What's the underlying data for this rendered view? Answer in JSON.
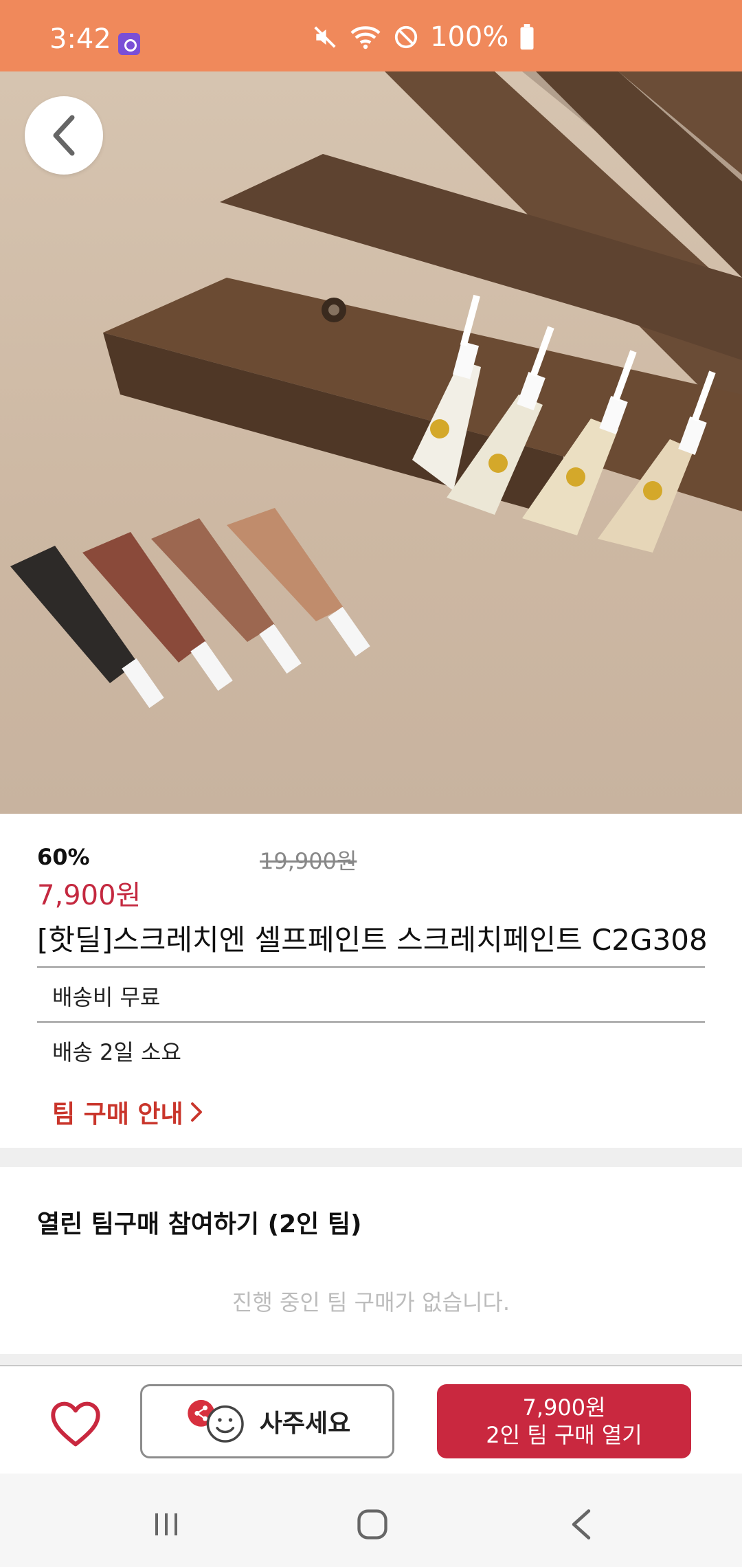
{
  "status_bar": {
    "time": "3:42",
    "battery_text": "100%",
    "icons": [
      "app-notification-icon",
      "mute-icon",
      "wifi-icon",
      "do-not-disturb-icon",
      "battery-icon"
    ]
  },
  "product": {
    "discount": "60%",
    "original_price": "19,900원",
    "sale_price": "7,900원",
    "title": "[핫딜]스크레치엔 셀프페인트 스크레치페인트 C2G308",
    "shipping_fee": "배송비 무료",
    "shipping_time": "배송 2일 소요",
    "team_guide_link": "팀 구매 안내"
  },
  "team_buy": {
    "heading": "열린 팀구매 참여하기 (2인 팀)",
    "empty_message": "진행 중인 팀 구매가 없습니다."
  },
  "actions": {
    "gift_label": "사주세요",
    "buy_price": "7,900원",
    "buy_label": "2인 팀 구매 열기"
  },
  "colors": {
    "status_bar": "#f0895b",
    "accent_red": "#c9283f",
    "link_red": "#c9352b"
  }
}
